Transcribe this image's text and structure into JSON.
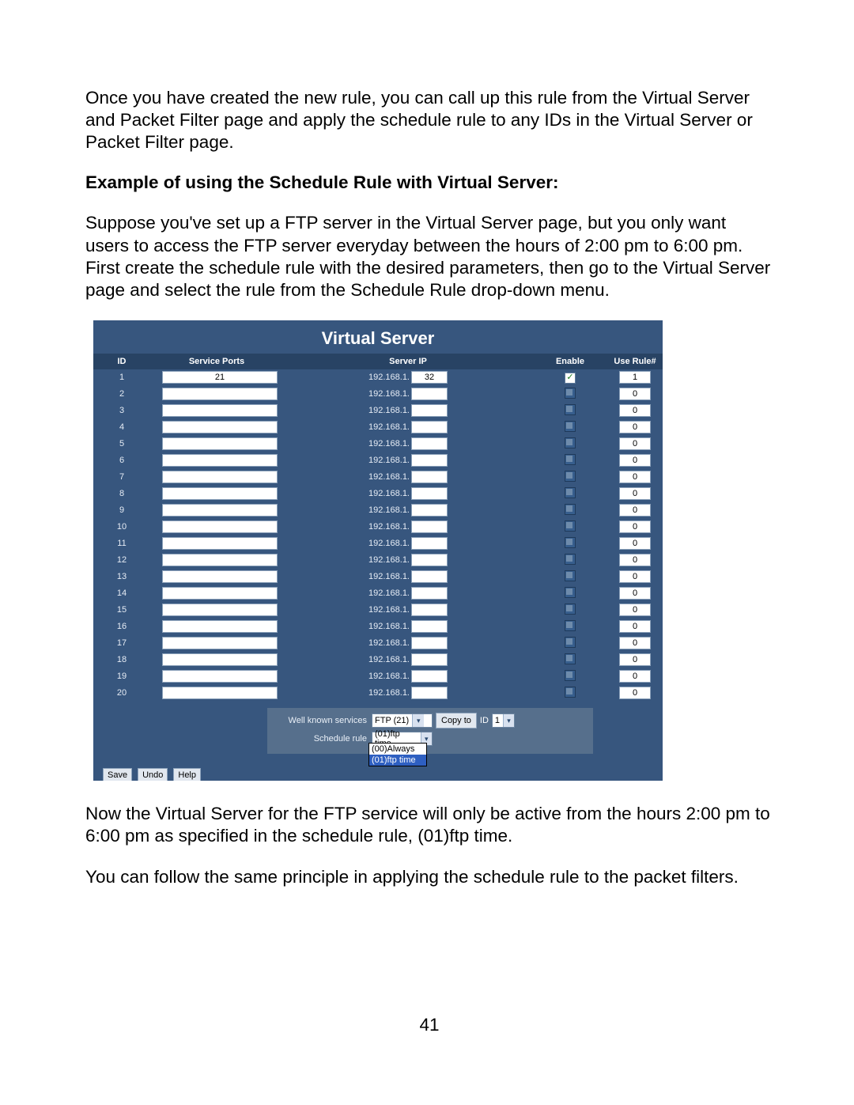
{
  "paragraphs": {
    "intro": "Once you have created the new rule, you can call up this rule from the Virtual Server and Packet Filter page and apply the schedule rule to any IDs in the Virtual Server or Packet Filter page.",
    "heading": "Example of using the Schedule Rule with Virtual Server:",
    "example": "Suppose you've set up a FTP server in the Virtual Server page, but you only want users to access the FTP server everyday between the hours of 2:00 pm to 6:00 pm. First create the schedule rule with the desired parameters, then go to the Virtual Server page and select the rule from the Schedule Rule drop-down menu.",
    "after1": "Now the Virtual Server for the FTP service will only be active from the hours 2:00 pm to 6:00 pm as specified in the schedule rule, (01)ftp time.",
    "after2": "You can follow the same principle in applying the schedule rule to the packet filters."
  },
  "page_number": "41",
  "screenshot": {
    "title": "Virtual Server",
    "headers": {
      "id": "ID",
      "service_ports": "Service Ports",
      "server_ip": "Server IP",
      "enable": "Enable",
      "use_rule": "Use Rule#"
    },
    "ip_prefix": "192.168.1.",
    "rows": [
      {
        "id": "1",
        "service": "21",
        "ip": "32",
        "enabled": true,
        "rule": "1"
      },
      {
        "id": "2",
        "service": "",
        "ip": "",
        "enabled": false,
        "rule": "0"
      },
      {
        "id": "3",
        "service": "",
        "ip": "",
        "enabled": false,
        "rule": "0"
      },
      {
        "id": "4",
        "service": "",
        "ip": "",
        "enabled": false,
        "rule": "0"
      },
      {
        "id": "5",
        "service": "",
        "ip": "",
        "enabled": false,
        "rule": "0"
      },
      {
        "id": "6",
        "service": "",
        "ip": "",
        "enabled": false,
        "rule": "0"
      },
      {
        "id": "7",
        "service": "",
        "ip": "",
        "enabled": false,
        "rule": "0"
      },
      {
        "id": "8",
        "service": "",
        "ip": "",
        "enabled": false,
        "rule": "0"
      },
      {
        "id": "9",
        "service": "",
        "ip": "",
        "enabled": false,
        "rule": "0"
      },
      {
        "id": "10",
        "service": "",
        "ip": "",
        "enabled": false,
        "rule": "0"
      },
      {
        "id": "11",
        "service": "",
        "ip": "",
        "enabled": false,
        "rule": "0"
      },
      {
        "id": "12",
        "service": "",
        "ip": "",
        "enabled": false,
        "rule": "0"
      },
      {
        "id": "13",
        "service": "",
        "ip": "",
        "enabled": false,
        "rule": "0"
      },
      {
        "id": "14",
        "service": "",
        "ip": "",
        "enabled": false,
        "rule": "0"
      },
      {
        "id": "15",
        "service": "",
        "ip": "",
        "enabled": false,
        "rule": "0"
      },
      {
        "id": "16",
        "service": "",
        "ip": "",
        "enabled": false,
        "rule": "0"
      },
      {
        "id": "17",
        "service": "",
        "ip": "",
        "enabled": false,
        "rule": "0"
      },
      {
        "id": "18",
        "service": "",
        "ip": "",
        "enabled": false,
        "rule": "0"
      },
      {
        "id": "19",
        "service": "",
        "ip": "",
        "enabled": false,
        "rule": "0"
      },
      {
        "id": "20",
        "service": "",
        "ip": "",
        "enabled": false,
        "rule": "0"
      }
    ],
    "well_known": {
      "label": "Well known services",
      "value": "FTP (21)",
      "schedule_label": "Schedule rule",
      "schedule_value": "(01)ftp time",
      "dropdown_options": [
        "(00)Always",
        "(01)ftp time"
      ],
      "dropdown_highlighted": 1,
      "copy_label": "Copy to",
      "copy_id_label": "ID",
      "copy_id_value": "1"
    },
    "bottom_buttons": [
      "Save",
      "Undo",
      "Help"
    ]
  }
}
